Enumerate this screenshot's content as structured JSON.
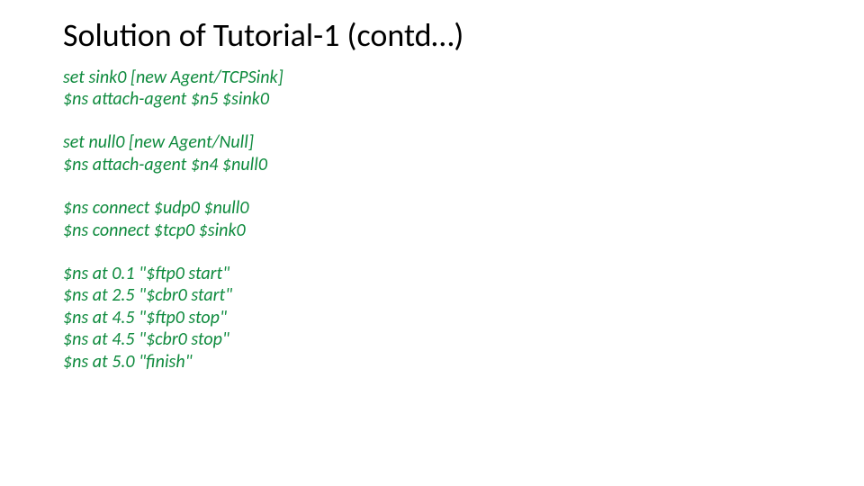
{
  "title": "Solution of Tutorial-1 (contd…)",
  "groups": [
    {
      "lines": [
        "set sink0 [new Agent/TCPSink]",
        "$ns attach-agent $n5 $sink0"
      ]
    },
    {
      "lines": [
        "set null0 [new Agent/Null]",
        "$ns attach-agent $n4 $null0"
      ]
    },
    {
      "lines": [
        "$ns connect $udp0 $null0",
        "$ns connect $tcp0 $sink0"
      ]
    },
    {
      "lines": [
        "$ns at 0.1 \"$ftp0 start\"",
        "$ns at 2.5 \"$cbr0 start\"",
        "$ns at 4.5 \"$ftp0 stop\"",
        "$ns at 4.5 \"$cbr0 stop\"",
        "$ns at 5.0 \"finish\""
      ]
    }
  ]
}
